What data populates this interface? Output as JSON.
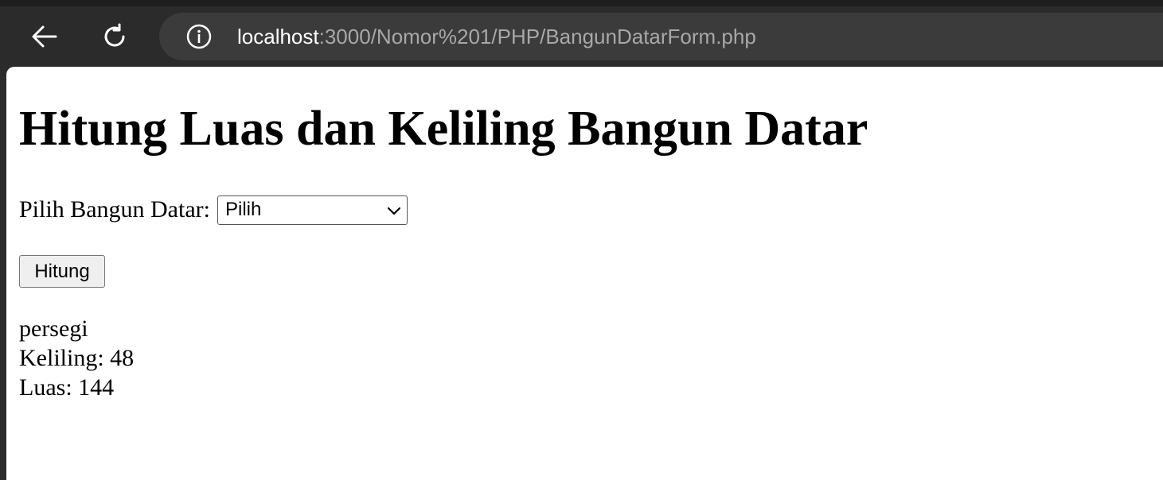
{
  "browser": {
    "url_host": "localhost",
    "url_path": ":3000/Nomor%201/PHP/BangunDatarForm.php"
  },
  "page": {
    "title": "Hitung Luas dan Keliling Bangun Datar",
    "select_label": "Pilih Bangun Datar:",
    "select_value": "Pilih",
    "button_label": "Hitung",
    "result": {
      "shape": "persegi",
      "keliling": "Keliling: 48",
      "luas": "Luas: 144"
    }
  },
  "colors": {
    "chrome_bg": "#2b2b2b",
    "address_bar_bg": "#3b3b3b",
    "page_bg": "#ffffff"
  },
  "icons": {
    "back": "arrow-left-icon",
    "reload": "reload-icon",
    "info": "info-icon",
    "select": "chevron-down-icon"
  }
}
